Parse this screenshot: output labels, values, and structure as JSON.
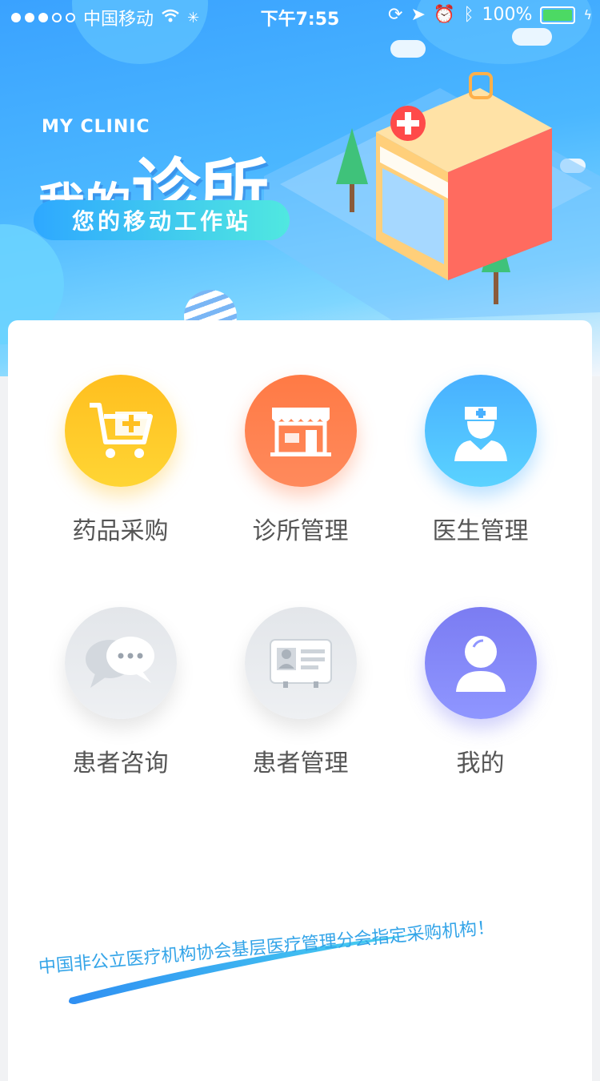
{
  "status_bar": {
    "carrier": "中国移动",
    "time": "下午7:55",
    "battery": "100%",
    "battery_level": 1.0
  },
  "hero": {
    "brand_en": "MY CLINIC",
    "brand_cn_part1": "我的",
    "brand_cn_part2": "诊所",
    "slogan": "您的移动工作站"
  },
  "menu": {
    "items": [
      {
        "label": "药品采购",
        "icon": "shopping-cart-plus-icon",
        "color": "#ffc629"
      },
      {
        "label": "诊所管理",
        "icon": "storefront-icon",
        "color": "#ff7c4d"
      },
      {
        "label": "医生管理",
        "icon": "doctor-icon",
        "color": "#4fbcff"
      },
      {
        "label": "患者咨询",
        "icon": "chat-bubbles-icon",
        "color": "#e8eaed"
      },
      {
        "label": "患者管理",
        "icon": "patient-card-icon",
        "color": "#e8eaed"
      },
      {
        "label": "我的",
        "icon": "user-profile-icon",
        "color": "#8487f6"
      }
    ]
  },
  "promo": {
    "text": "中国非公立医疗机构协会基层医疗管理分会指定采购机构！"
  }
}
